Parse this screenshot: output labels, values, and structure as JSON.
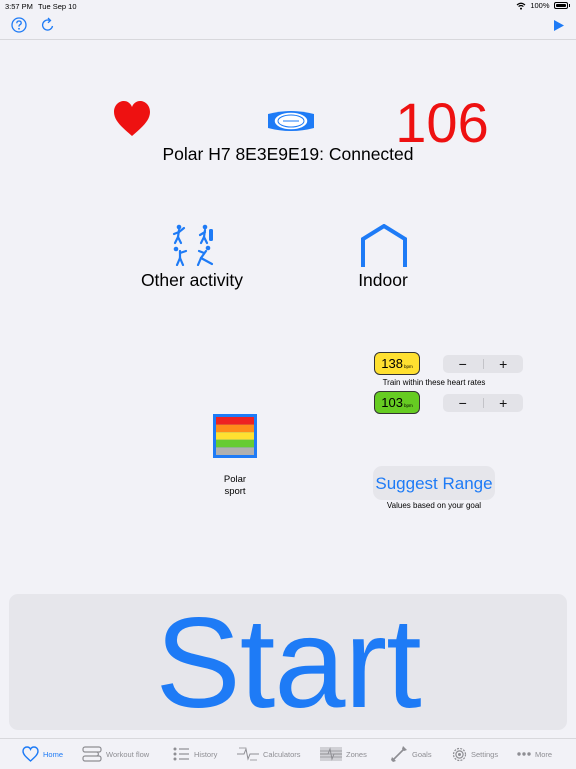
{
  "status_bar": {
    "time": "3:57 PM",
    "date": "Tue Sep 10",
    "battery": "100%"
  },
  "topbar": {
    "help_icon": "question-circle-icon",
    "refresh_icon": "refresh-icon",
    "play_icon": "play-icon"
  },
  "sensor": {
    "heart_rate": "106",
    "connection_text": "Polar H7 8E3E9E19: Connected"
  },
  "activity": {
    "type_label": "Other activity",
    "location_label": "Indoor"
  },
  "ranges": {
    "upper": "138",
    "lower": "103",
    "unit": "bpm",
    "caption": "Train within these heart rates",
    "minus": "−",
    "plus": "+"
  },
  "sport": {
    "line1": "Polar",
    "line2": "sport"
  },
  "suggest": {
    "button_label": "Suggest Range",
    "caption": "Values based on your goal"
  },
  "start": {
    "label": "Start"
  },
  "tabs": [
    {
      "label": "Home"
    },
    {
      "label": "Workout flow"
    },
    {
      "label": "History"
    },
    {
      "label": "Calculators"
    },
    {
      "label": "Zones"
    },
    {
      "label": "Goals"
    },
    {
      "label": "Settings"
    },
    {
      "label": "More"
    }
  ],
  "colors": {
    "accent": "#1e7bf6",
    "heart": "#ee1111",
    "upper_badge": "#ffe030",
    "lower_badge": "#66cc22",
    "tab_inactive": "#8e8e93"
  }
}
